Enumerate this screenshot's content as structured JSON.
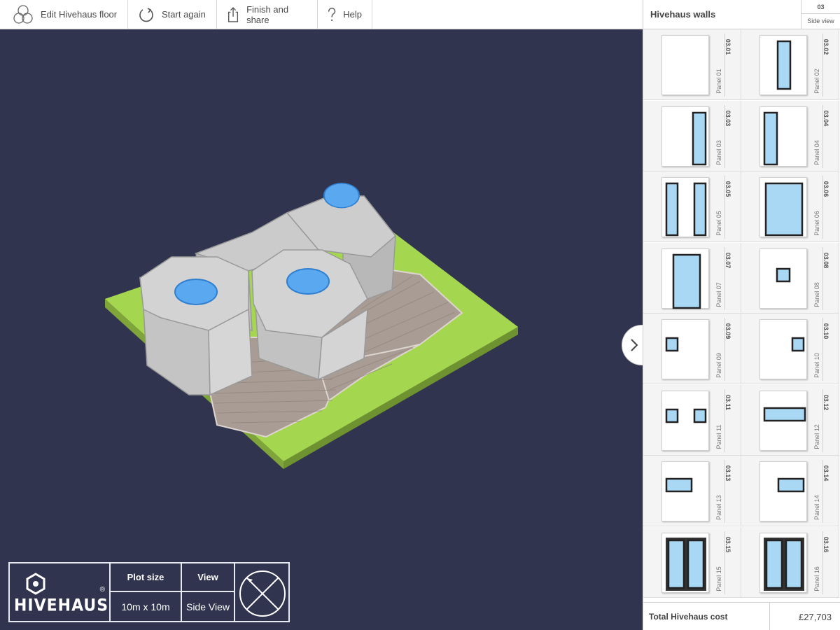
{
  "toolbar": {
    "edit_floor": "Edit Hivehaus floor",
    "start_again": "Start again",
    "finish_share": "Finish and share",
    "help": "Help"
  },
  "panel": {
    "title": "Hivehaus walls",
    "code": "03",
    "view": "Side view",
    "items": [
      {
        "code": "03.01",
        "name": "Panel 01",
        "icon": "blank-wall"
      },
      {
        "code": "03.02",
        "name": "Panel 02",
        "icon": "narrow-tall-window-center"
      },
      {
        "code": "03.03",
        "name": "Panel 03",
        "icon": "narrow-tall-window-right"
      },
      {
        "code": "03.04",
        "name": "Panel 04",
        "icon": "narrow-tall-window-left"
      },
      {
        "code": "03.05",
        "name": "Panel 05",
        "icon": "two-narrow-windows"
      },
      {
        "code": "03.06",
        "name": "Panel 06",
        "icon": "wide-tall-window"
      },
      {
        "code": "03.07",
        "name": "Panel 07",
        "icon": "door"
      },
      {
        "code": "03.08",
        "name": "Panel 08",
        "icon": "small-window-center"
      },
      {
        "code": "03.09",
        "name": "Panel 09",
        "icon": "small-window-left"
      },
      {
        "code": "03.10",
        "name": "Panel 10",
        "icon": "small-window-right"
      },
      {
        "code": "03.11",
        "name": "Panel 11",
        "icon": "two-small-windows"
      },
      {
        "code": "03.12",
        "name": "Panel 12",
        "icon": "wide-strip-window"
      },
      {
        "code": "03.13",
        "name": "Panel 13",
        "icon": "strip-window-left"
      },
      {
        "code": "03.14",
        "name": "Panel 14",
        "icon": "strip-window-right"
      },
      {
        "code": "03.15",
        "name": "Panel 15",
        "icon": "double-glazed-door"
      },
      {
        "code": "03.16",
        "name": "Panel 16",
        "icon": "double-glazed-door"
      }
    ],
    "total_label": "Total Hivehaus cost",
    "total_value": "£27,703"
  },
  "info": {
    "logo_text": "HIVEHAUS",
    "logo_mark": "®",
    "plot_label": "Plot size",
    "plot_value": "10m x 10m",
    "view_label": "View",
    "view_value": "Side View"
  },
  "colors": {
    "background": "#31344f",
    "grass": "#a4d64f",
    "module": "#cfcfcf",
    "skylight": "#5aa8f0",
    "deck": "#a89c94"
  }
}
